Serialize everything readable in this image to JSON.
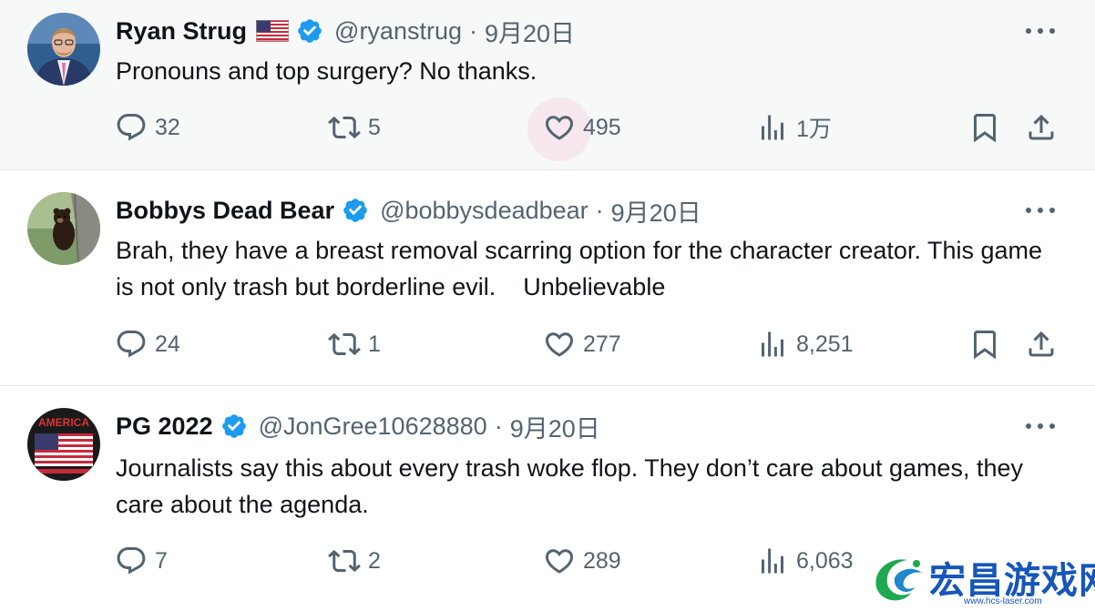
{
  "tweets": [
    {
      "name": "Ryan Strug",
      "handle": "@ryanstrug",
      "sep": "·",
      "time": "9月20日",
      "text": "Pronouns and top surgery? No thanks.",
      "replies": "32",
      "retweets": "5",
      "likes": "495",
      "views": "1万",
      "has_flag": true
    },
    {
      "name": "Bobbys Dead Bear",
      "handle": "@bobbysdeadbear",
      "sep": "·",
      "time": "9月20日",
      "text": "Brah, they have a breast removal scarring option for the character creator. This game is not only trash but borderline evil.    Unbelievable",
      "replies": "24",
      "retweets": "1",
      "likes": "277",
      "views": "8,251"
    },
    {
      "name": "PG 2022",
      "handle": "@JonGree10628880",
      "sep": "·",
      "time": "9月20日",
      "text": "Journalists say this about every trash woke flop. They don’t care about games, they care about the agenda.",
      "replies": "7",
      "retweets": "2",
      "likes": "289",
      "views": "6,063",
      "avatar_text": "AMERICA"
    }
  ],
  "watermark": {
    "text": "宏昌游戏网",
    "url": "www.hcs-laser.com"
  },
  "colors": {
    "verified": "#1d9bf0",
    "secondary_text": "#536471",
    "hover_bg": "#f7f8f8",
    "like_hover": "#f91880"
  },
  "icons": [
    "reply-icon",
    "retweet-icon",
    "like-icon",
    "views-icon",
    "bookmark-icon",
    "share-icon",
    "more-icon",
    "verified-badge-icon",
    "us-flag-icon"
  ]
}
